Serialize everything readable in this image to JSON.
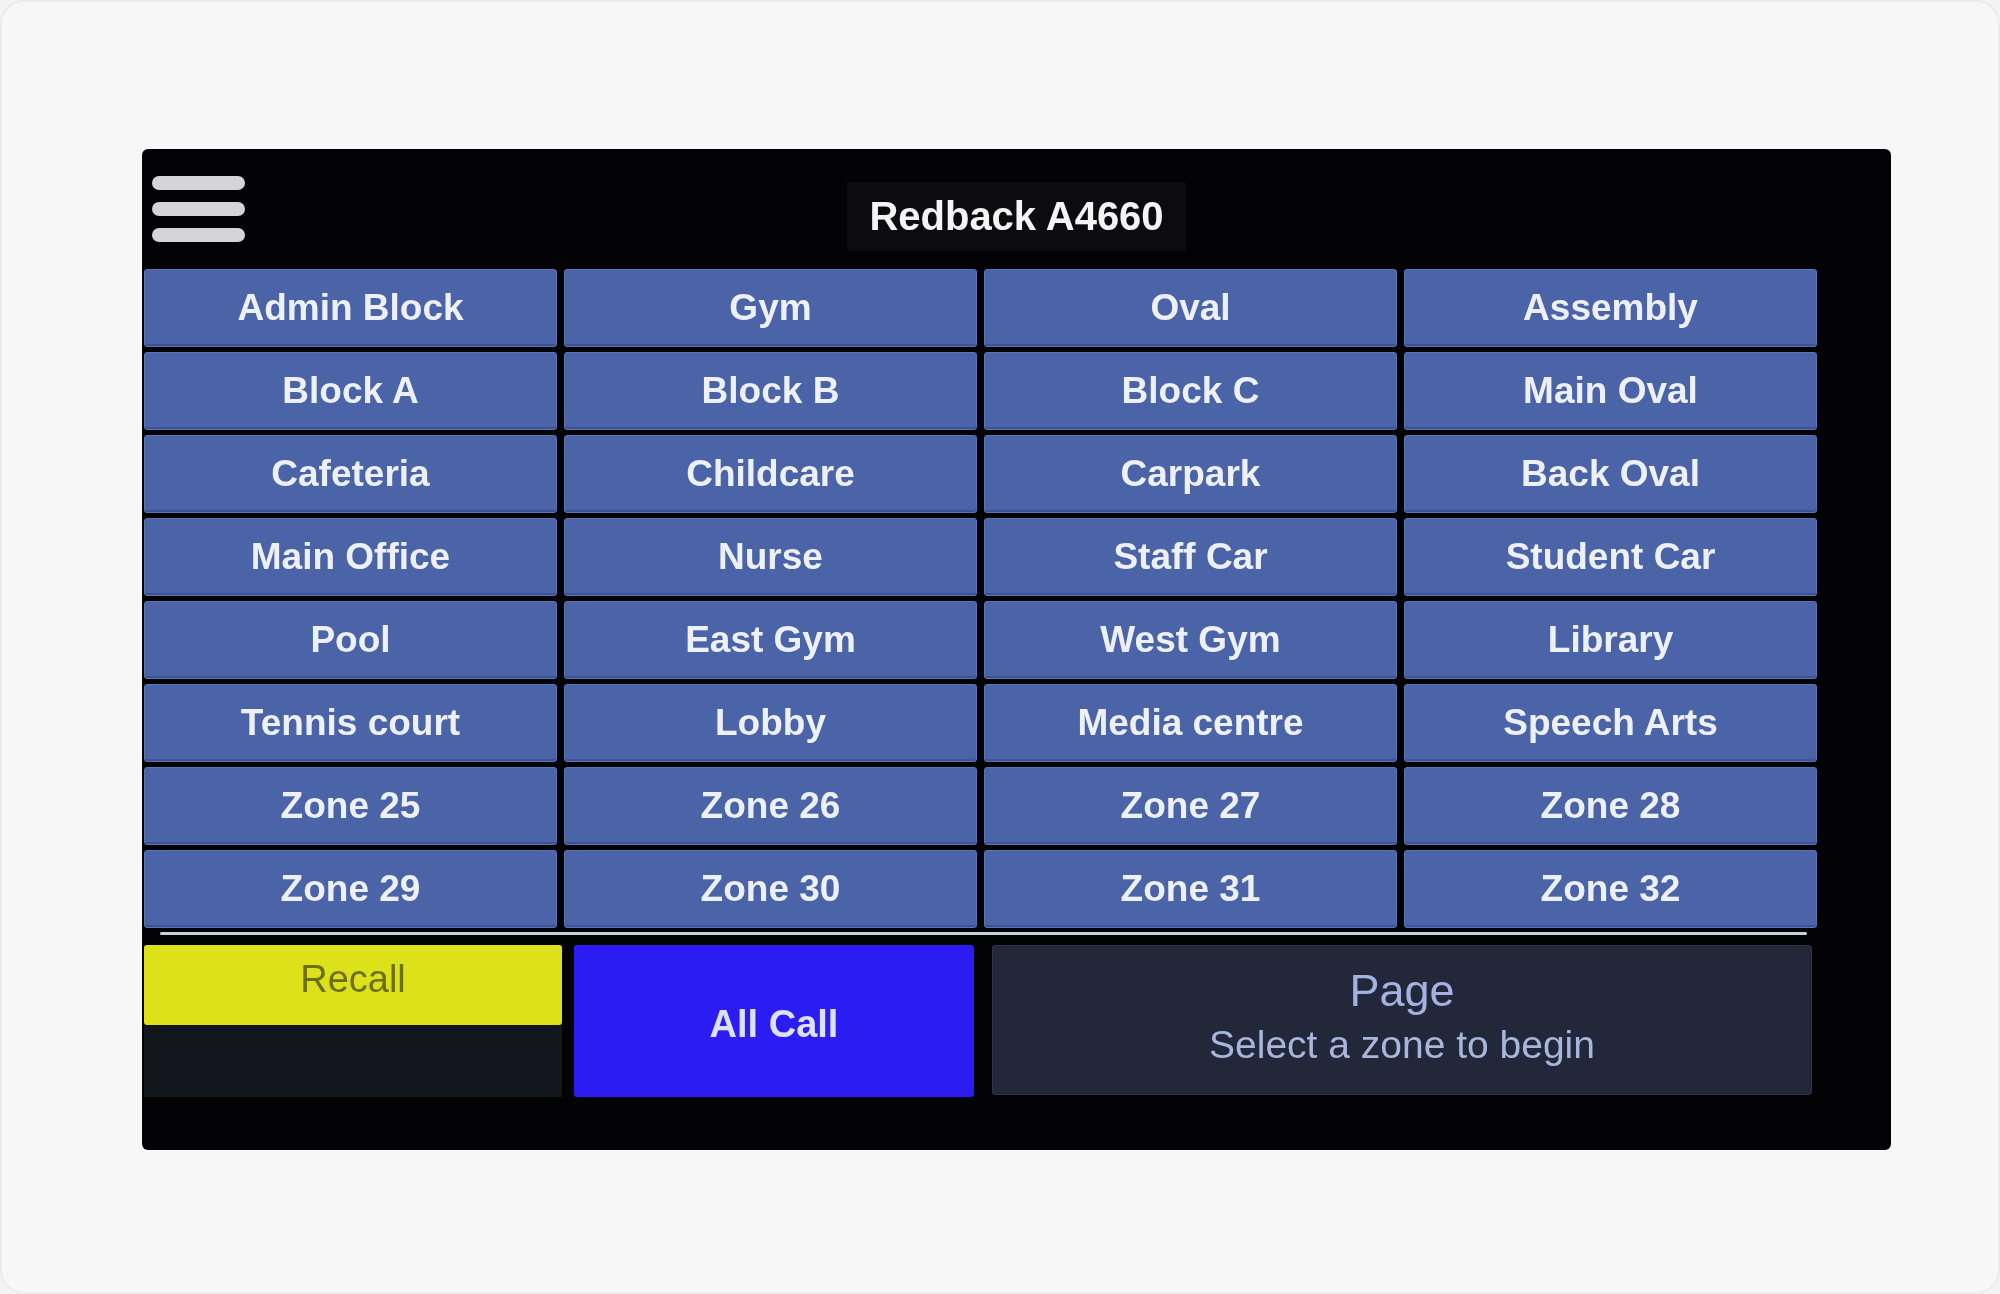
{
  "header": {
    "title": "Redback A4660"
  },
  "zones": [
    {
      "label": "Admin Block",
      "selected": false
    },
    {
      "label": "Gym",
      "selected": false
    },
    {
      "label": "Oval",
      "selected": false
    },
    {
      "label": "Assembly",
      "selected": false
    },
    {
      "label": "Block A",
      "selected": false
    },
    {
      "label": "Block B",
      "selected": false
    },
    {
      "label": "Block C",
      "selected": false
    },
    {
      "label": "Main Oval",
      "selected": false
    },
    {
      "label": "Cafeteria",
      "selected": false
    },
    {
      "label": "Childcare",
      "selected": false
    },
    {
      "label": "Carpark",
      "selected": false
    },
    {
      "label": "Back Oval",
      "selected": false
    },
    {
      "label": "Main Office",
      "selected": false
    },
    {
      "label": "Nurse",
      "selected": false
    },
    {
      "label": "Staff Car",
      "selected": false
    },
    {
      "label": "Student Car",
      "selected": false
    },
    {
      "label": "Pool",
      "selected": false
    },
    {
      "label": "East Gym",
      "selected": false
    },
    {
      "label": "West Gym",
      "selected": false
    },
    {
      "label": "Library",
      "selected": false
    },
    {
      "label": "Tennis court",
      "selected": false
    },
    {
      "label": "Lobby",
      "selected": false
    },
    {
      "label": "Media centre",
      "selected": false
    },
    {
      "label": "Speech Arts",
      "selected": false
    },
    {
      "label": "Zone 25",
      "selected": false
    },
    {
      "label": "Zone 26",
      "selected": false
    },
    {
      "label": "Zone 27",
      "selected": false
    },
    {
      "label": "Zone 28",
      "selected": false
    },
    {
      "label": "Zone 29",
      "selected": false
    },
    {
      "label": "Zone 30",
      "selected": false
    },
    {
      "label": "Zone 31",
      "selected": false
    },
    {
      "label": "Zone 32",
      "selected": false
    }
  ],
  "actions": [
    {
      "kind": "recall",
      "label": "Recall"
    },
    {
      "kind": "all_call",
      "label": "All Call"
    }
  ],
  "page_panel": {
    "title": "Page",
    "status": "Select a zone to begin"
  }
}
